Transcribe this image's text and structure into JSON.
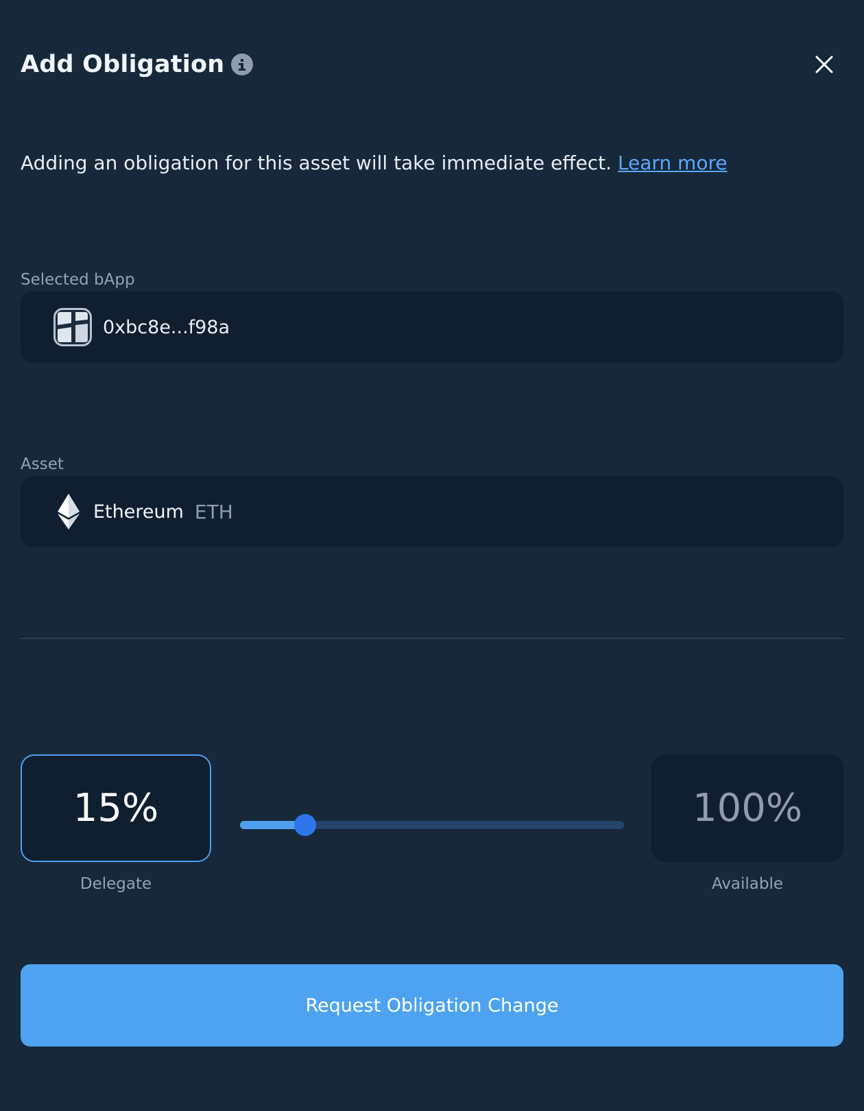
{
  "header": {
    "title": "Add Obligation",
    "info_icon": "info-icon",
    "close_icon": "close-icon"
  },
  "description": {
    "text": "Adding an obligation for this asset will take immediate effect. ",
    "link": "Learn more"
  },
  "bapp": {
    "label": "Selected bApp",
    "address": "0xbc8e...f98a",
    "icon": "bapp-avatar-icon"
  },
  "asset": {
    "label": "Asset",
    "name": "Ethereum",
    "symbol": "ETH",
    "icon": "ethereum-icon"
  },
  "allocation": {
    "delegate_value": "15%",
    "delegate_label": "Delegate",
    "available_value": "100%",
    "available_label": "Available",
    "slider_fraction": 0.17
  },
  "action": {
    "button_label": "Request Obligation Change"
  },
  "colors": {
    "background": "#16283a",
    "field_background": "#0f1f30",
    "accent": "#4da3f0",
    "link": "#5ba8ff",
    "slider_thumb": "#2f76ec"
  }
}
